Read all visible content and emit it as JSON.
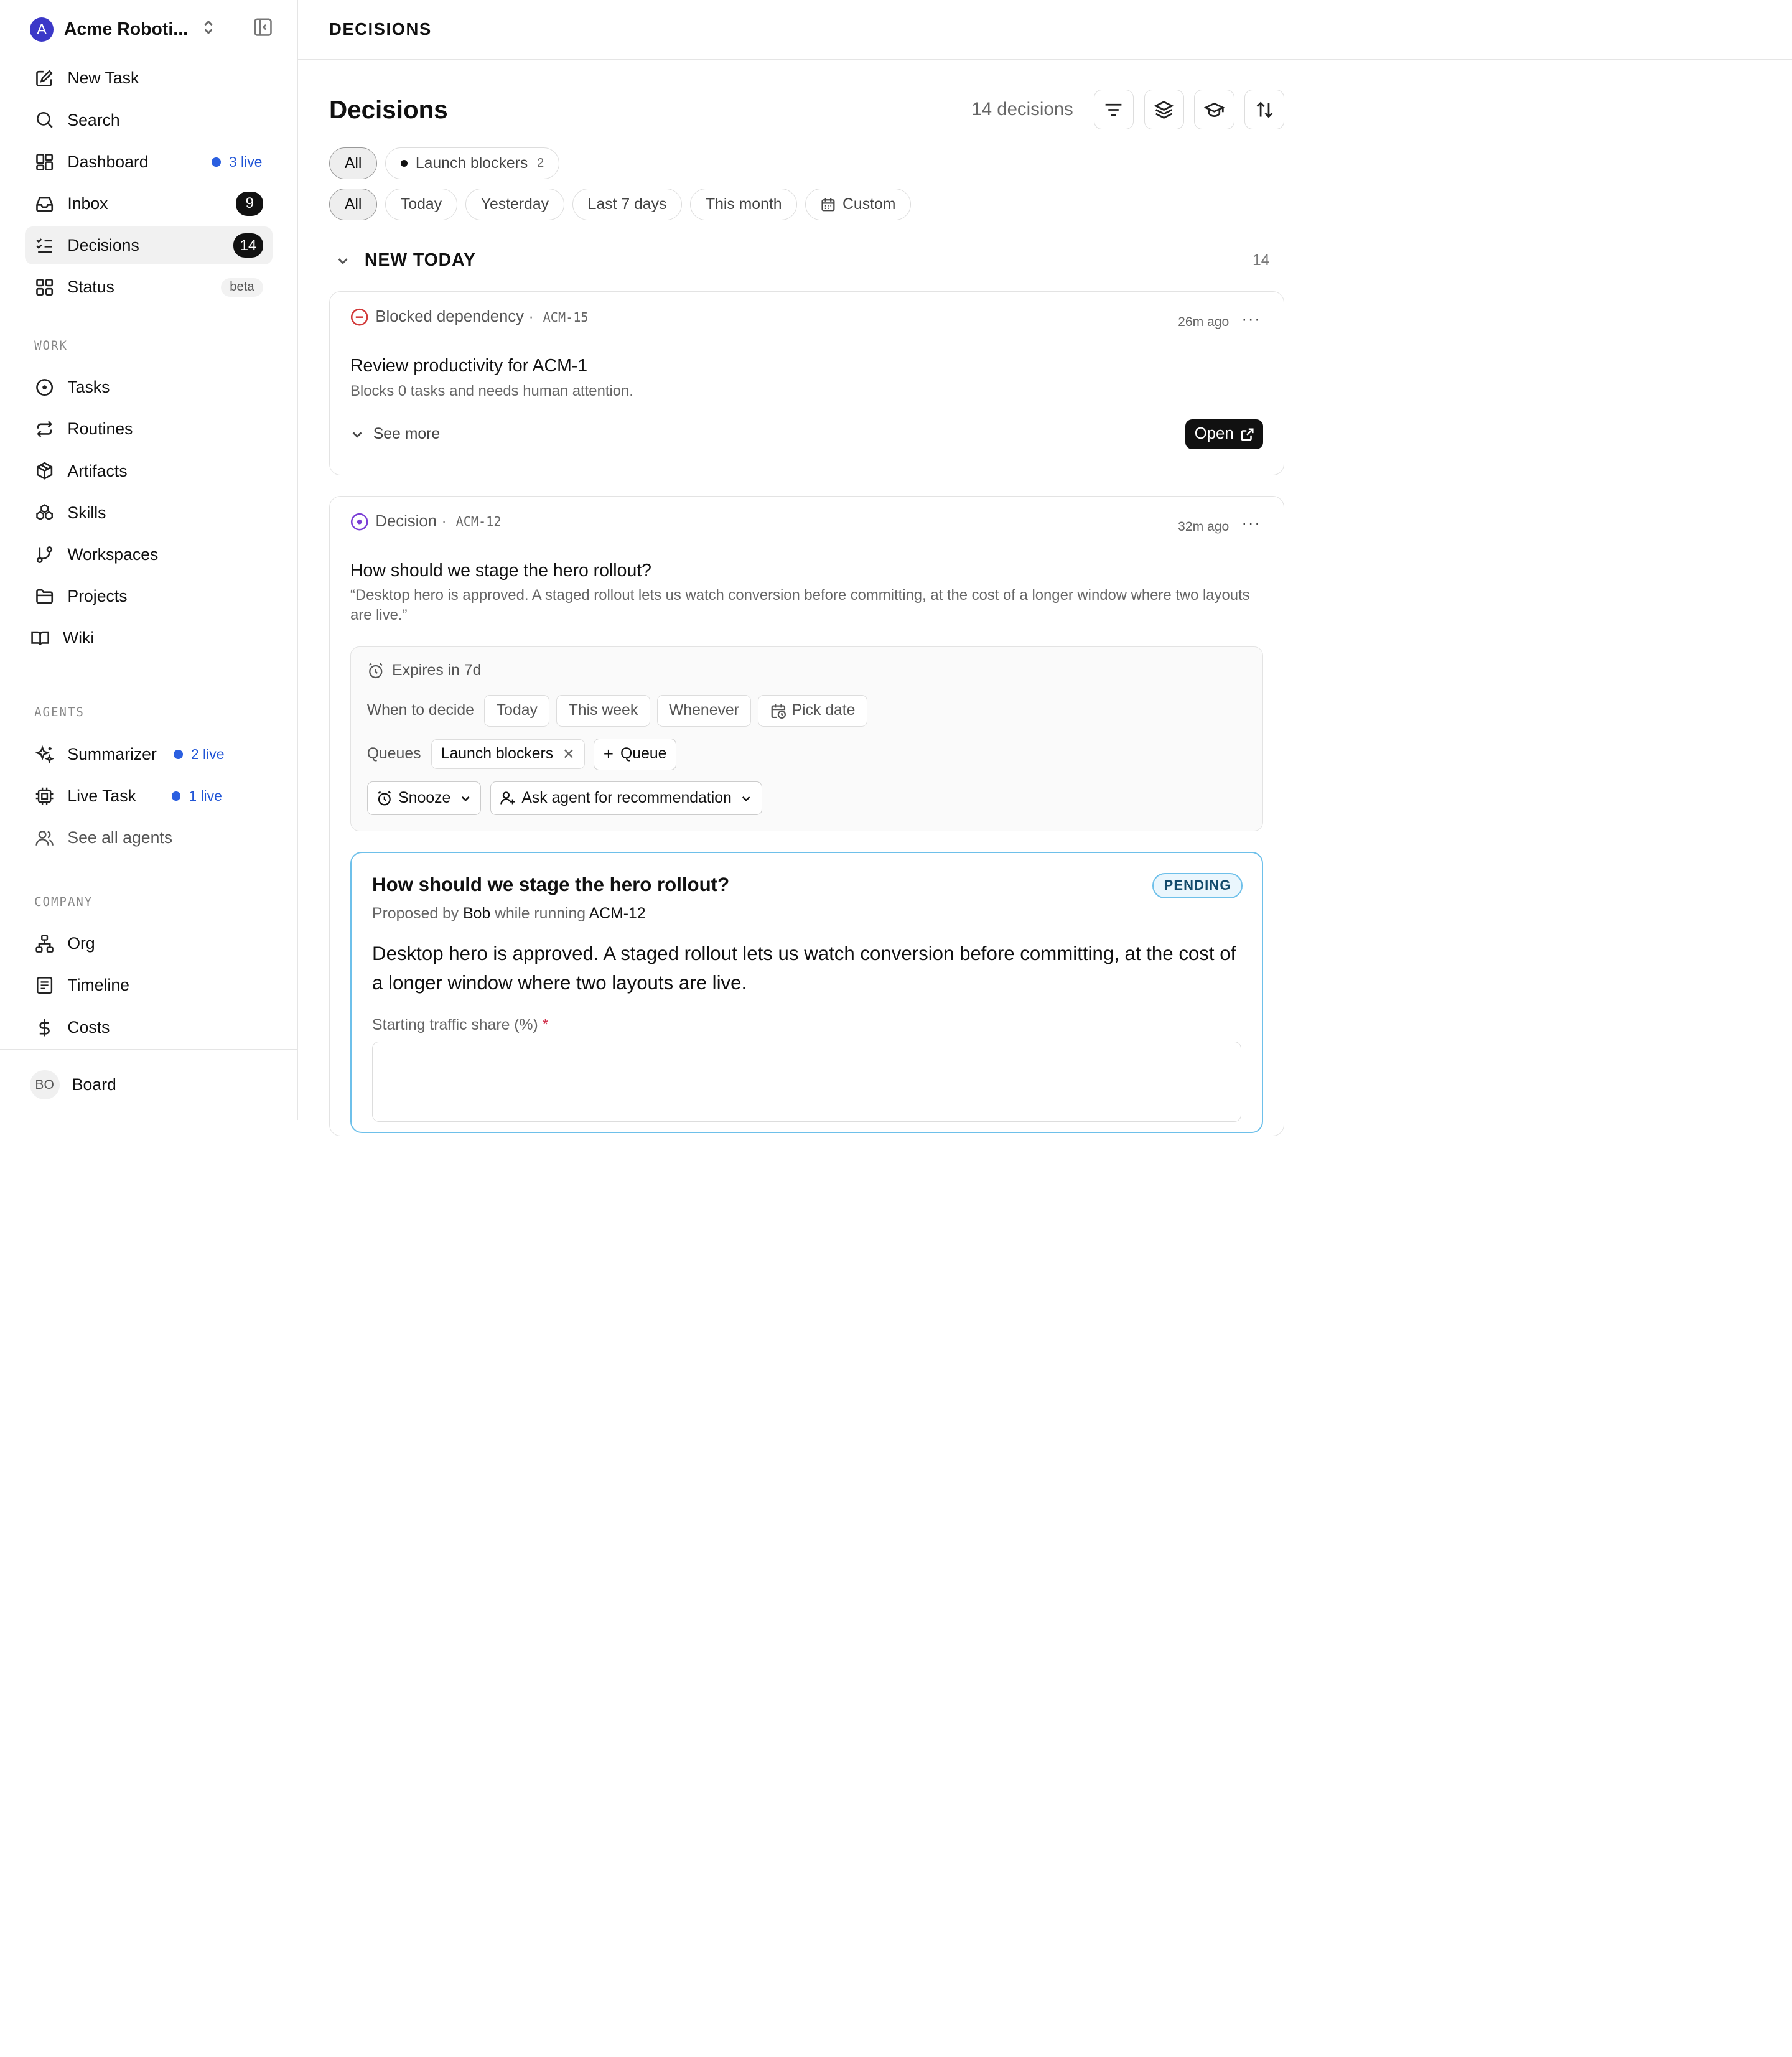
{
  "workspace": {
    "logo_letter": "A",
    "name": "Acme Roboti..."
  },
  "nav": {
    "main": [
      {
        "label": "New Task",
        "icon": "edit-icon"
      },
      {
        "label": "Search",
        "icon": "search-icon"
      },
      {
        "label": "Dashboard",
        "icon": "dashboard-icon",
        "live": "3 live"
      },
      {
        "label": "Inbox",
        "icon": "inbox-icon",
        "count": "9"
      },
      {
        "label": "Decisions",
        "icon": "list-check-icon",
        "count": "14",
        "active": true
      },
      {
        "label": "Status",
        "icon": "grid-icon",
        "badge": "beta"
      }
    ],
    "work_label": "WORK",
    "work": [
      {
        "label": "Tasks",
        "icon": "circle-dot-icon"
      },
      {
        "label": "Routines",
        "icon": "repeat-icon"
      },
      {
        "label": "Artifacts",
        "icon": "package-icon"
      },
      {
        "label": "Skills",
        "icon": "boxes-icon"
      },
      {
        "label": "Workspaces",
        "icon": "git-branch-icon"
      },
      {
        "label": "Projects",
        "icon": "folder-icon"
      },
      {
        "label": "Wiki",
        "icon": "book-icon"
      }
    ],
    "agents_label": "AGENTS",
    "agents": [
      {
        "label": "Summarizer",
        "icon": "sparkles-icon",
        "live": "2 live"
      },
      {
        "label": "Live Task",
        "icon": "cpu-icon",
        "live": "1 live"
      },
      {
        "label": "See all agents",
        "icon": "users-icon"
      }
    ],
    "company_label": "COMPANY",
    "company": [
      {
        "label": "Org",
        "icon": "org-icon"
      },
      {
        "label": "Timeline",
        "icon": "timeline-icon"
      },
      {
        "label": "Costs",
        "icon": "dollar-icon"
      }
    ]
  },
  "footer": {
    "avatar": "BO",
    "name": "Board"
  },
  "topbar": {
    "title": "DECISIONS"
  },
  "page": {
    "title": "Decisions",
    "count_label": "14 decisions",
    "queue_chips": [
      {
        "label": "All",
        "selected": true
      },
      {
        "label": "Launch blockers",
        "count": "2"
      }
    ],
    "date_chips": [
      {
        "label": "All",
        "selected": true
      },
      {
        "label": "Today"
      },
      {
        "label": "Yesterday"
      },
      {
        "label": "Last 7 days"
      },
      {
        "label": "This month"
      },
      {
        "label": "Custom"
      }
    ]
  },
  "group": {
    "title": "NEW TODAY",
    "count": "14"
  },
  "card1": {
    "kind": "Blocked dependency",
    "code": "ACM-15",
    "time": "26m ago",
    "more": "···",
    "title": "Review productivity for ACM-1",
    "sub": "Blocks 0 tasks and needs human attention.",
    "see_more": "See more",
    "open": "Open"
  },
  "card2": {
    "kind": "Decision",
    "code": "ACM-12",
    "time": "32m ago",
    "more": "···",
    "title": "How should we stage the hero rollout?",
    "sub": "“Desktop hero is approved. A staged rollout lets us watch conversion before committing, at the cost of a longer window where two layouts are live.”",
    "expires": "Expires in 7d",
    "when_label": "When to decide",
    "when_options": [
      "Today",
      "This week",
      "Whenever",
      "Pick date"
    ],
    "queues_label": "Queues",
    "queue_tag": "Launch blockers",
    "add_queue": "Queue",
    "snooze": "Snooze",
    "ask_agent": "Ask agent for recommendation"
  },
  "proposal": {
    "title": "How should we stage the hero rollout?",
    "status": "PENDING",
    "proposed_by_prefix": "Proposed by",
    "proposer": "Bob",
    "while_running": "while running",
    "task": "ACM-12",
    "body": "Desktop hero is approved. A staged rollout lets us watch conversion before committing, at the cost of a longer window where two layouts are live.",
    "field_label": "Starting traffic share (%)",
    "required_mark": "*"
  }
}
